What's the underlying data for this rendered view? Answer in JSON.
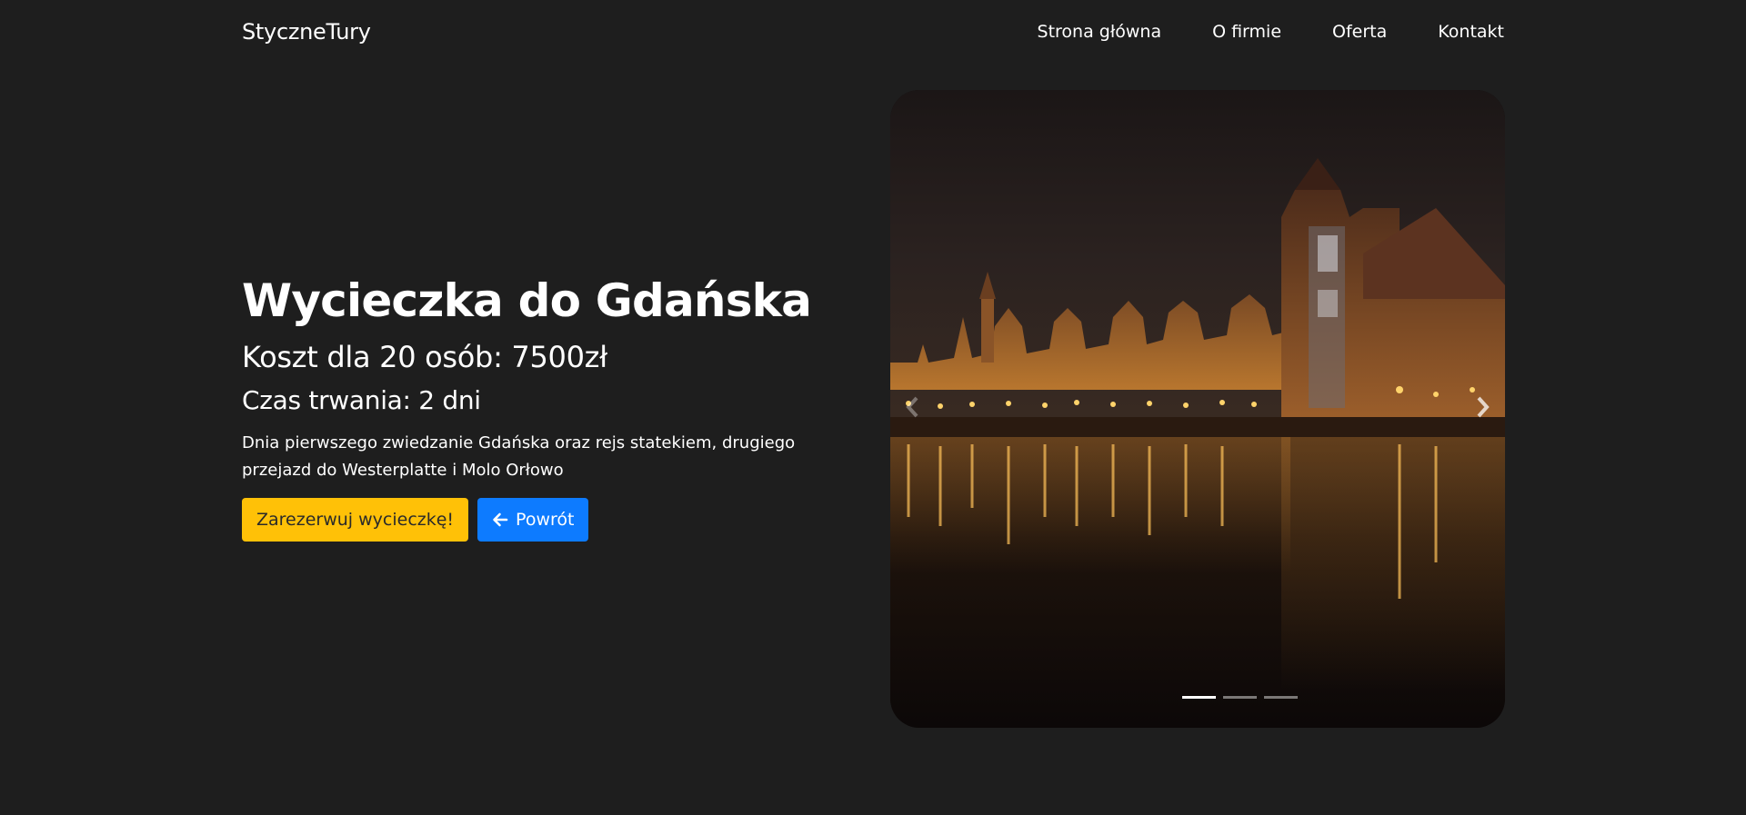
{
  "nav": {
    "brand": "StyczneTury",
    "links": [
      "Strona główna",
      "O firmie",
      "Oferta",
      "Kontakt"
    ]
  },
  "trip": {
    "title": "Wycieczka do Gdańska",
    "cost": "Koszt dla 20 osób: 7500zł",
    "duration": "Czas trwania: 2 dni",
    "description": "Dnia pierwszego zwiedzanie Gdańska oraz rejs statekiem, drugiego przejazd do Westerplatte i Molo Orłowo"
  },
  "buttons": {
    "reserve": "Zarezerwuj wycieczkę!",
    "back": "Powrót",
    "back_icon": "arrow-left-icon"
  },
  "carousel": {
    "slide_count": 3,
    "active_index": 0
  },
  "colors": {
    "background": "#1e1e1e",
    "reserve_button": "#ffc107",
    "back_button": "#0d7bff"
  }
}
